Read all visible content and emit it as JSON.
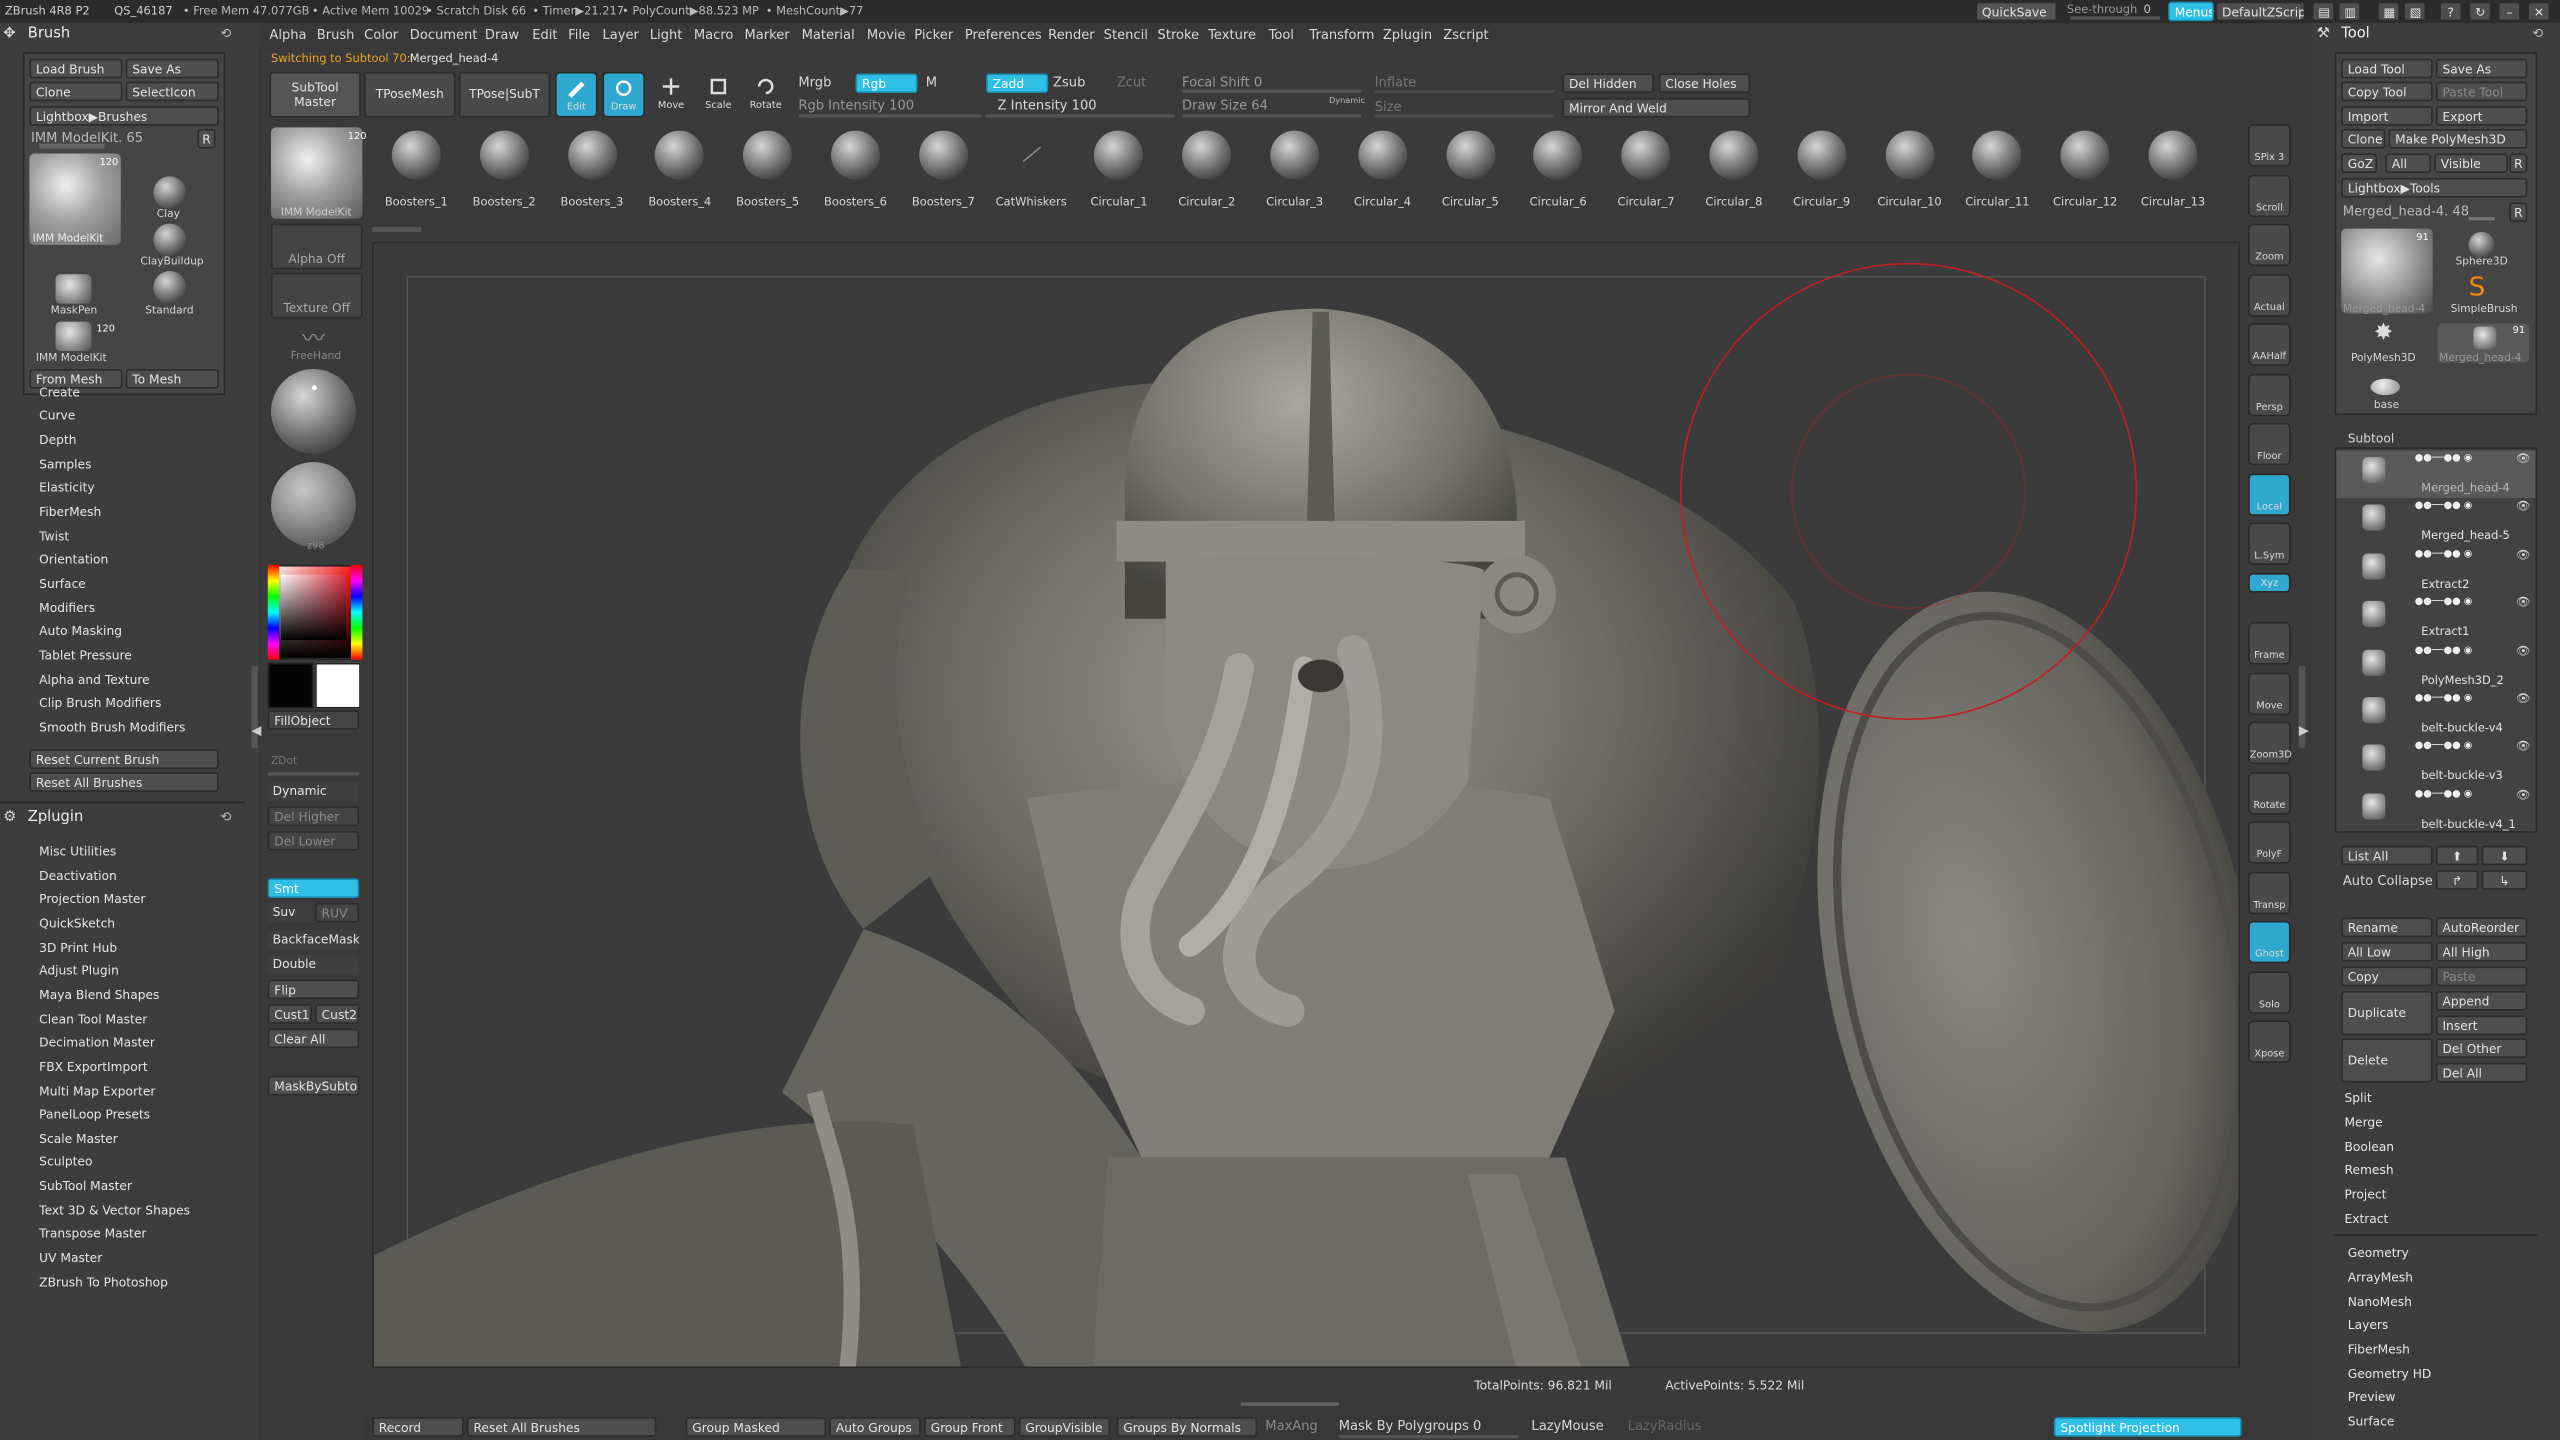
{
  "titlebar": {
    "app": "ZBrush 4R8 P2",
    "qs": "QS_46187",
    "free_mem": "• Free Mem 47.077GB",
    "active_mem": "• Active Mem 10029",
    "scratch": "• Scratch Disk 66",
    "timer": "• Timer▶21.217",
    "polycount": "• PolyCount▶88.523 MP",
    "meshcount": "• MeshCount▶77",
    "quicksave": "QuickSave",
    "seethrough": "See-through",
    "seethrough_value": "0",
    "menus": "Menus",
    "default_zscript": "DefaultZScript"
  },
  "menubar": [
    "Alpha",
    "Brush",
    "Color",
    "Document",
    "Draw",
    "Edit",
    "File",
    "Layer",
    "Light",
    "Macro",
    "Marker",
    "Material",
    "Movie",
    "Picker",
    "Preferences",
    "Render",
    "Stencil",
    "Stroke",
    "Texture",
    "Tool",
    "Transform",
    "Zplugin",
    "Zscript"
  ],
  "status_msg": "Switching to Subtool 70:",
  "status_value": "Merged_head-4",
  "top_toolbar": {
    "subtool_master": "SubTool Master",
    "tposemesh": "TPoseMesh",
    "tpose_subt": "TPose|SubT",
    "edit": "Edit",
    "draw": "Draw",
    "move": "Move",
    "scale": "Scale",
    "rotate": "Rotate",
    "mrgb": "Mrgb",
    "rgb": "Rgb",
    "m": "M",
    "rgb_intensity": "Rgb Intensity 100",
    "zadd": "Zadd",
    "zsub": "Zsub",
    "zcut": "Zcut",
    "z_intensity": "Z Intensity 100",
    "focal_shift": "Focal Shift 0",
    "draw_size": "Draw Size 64",
    "dynamic": "Dynamic",
    "inflate": "Inflate",
    "size": "Size",
    "del_hidden": "Del Hidden",
    "close_holes": "Close Holes",
    "mirror_weld": "Mirror And Weld"
  },
  "brush_shelf": [
    "Boosters_1",
    "Boosters_2",
    "Boosters_3",
    "Boosters_4",
    "Boosters_5",
    "Boosters_6",
    "Boosters_7",
    "CatWhiskers",
    "Circular_1",
    "Circular_2",
    "Circular_3",
    "Circular_4",
    "Circular_5",
    "Circular_6",
    "Circular_7",
    "Circular_8",
    "Circular_9",
    "Circular_10",
    "Circular_11",
    "Circular_12",
    "Circular_13"
  ],
  "left_panel": {
    "title": "Brush",
    "load_brush": "Load Brush",
    "save_as": "Save As",
    "clone": "Clone",
    "select_icon": "SelectIcon",
    "lightbox": "Lightbox▶Brushes",
    "imm_label": "IMM ModelKit. 65",
    "r": "R",
    "imm_thumb": "IMM ModelKit",
    "imm_count": "120",
    "clay": "Clay",
    "claybuildup": "ClayBuildup",
    "maskpen": "MaskPen",
    "standard": "Standard",
    "imm_thumb2": "IMM ModelKit",
    "imm_count2": "120",
    "from_mesh": "From Mesh",
    "to_mesh": "To Mesh",
    "sections": [
      "Create",
      "Curve",
      "Depth",
      "Samples",
      "Elasticity",
      "FiberMesh",
      "Twist",
      "Orientation",
      "Surface",
      "Modifiers",
      "Auto Masking",
      "Tablet Pressure",
      "Alpha and Texture",
      "Clip Brush Modifiers",
      "Smooth Brush Modifiers"
    ],
    "reset_current": "Reset Current Brush",
    "reset_all": "Reset All Brushes",
    "zplugin_title": "Zplugin",
    "plugins": [
      "Misc Utilities",
      "Deactivation",
      "Projection Master",
      "QuickSketch",
      "3D Print Hub",
      "Adjust Plugin",
      "Maya Blend Shapes",
      "Clean Tool Master",
      "Decimation Master",
      "FBX ExportImport",
      "Multi Map Exporter",
      "PanelLoop Presets",
      "Scale Master",
      "Sculpteo",
      "SubTool Master",
      "Text 3D & Vector Shapes",
      "Transpose Master",
      "UV Master",
      "ZBrush To Photoshop"
    ]
  },
  "vbar": {
    "imm_thumb": "IMM ModelKit",
    "imm_count": "120",
    "alpha_off": "Alpha Off",
    "texture_off": "Texture Off",
    "freehand": "FreeHand",
    "matcap": "z98",
    "fill_object": "FillObject",
    "zdot": "ZDot",
    "dynamic": "Dynamic",
    "del_higher": "Del Higher",
    "del_lower": "Del Lower",
    "smt": "Smt",
    "suv": "Suv",
    "ruv": "RUV",
    "backface": "BackfaceMask",
    "double": "Double",
    "flip": "Flip",
    "cust1": "Cust1",
    "cust2": "Cust2",
    "clear_all": "Clear All",
    "mask_by_subtool": "MaskBySubtool"
  },
  "right_shelf": [
    "SPix 3",
    "Scroll",
    "Zoom",
    "Actual",
    "AAHalf",
    "Persp",
    "Floor",
    "Local",
    "L.Sym",
    "Xyz",
    "Frame",
    "Move",
    "Zoom3D",
    "Rotate",
    "PolyF",
    "Transp",
    "Ghost",
    "Solo",
    "Xpose"
  ],
  "tool_panel": {
    "title": "Tool",
    "load_tool": "Load Tool",
    "save_as": "Save As",
    "copy_tool": "Copy Tool",
    "paste_tool": "Paste Tool",
    "import": "Import",
    "export": "Export",
    "clone": "Clone",
    "make_polymesh": "Make PolyMesh3D",
    "goz": "GoZ",
    "all": "All",
    "visible": "Visible",
    "r": "R",
    "lightbox": "Lightbox▶Tools",
    "merged_label": "Merged_head-4. 48",
    "r2": "R",
    "thumb_merged": "Merged_head-4",
    "thumb_count": "91",
    "sphere3d": "Sphere3D",
    "simplebrush": "SimpleBrush",
    "polymesh3d": "PolyMesh3D",
    "merged_small": "Merged_head-4",
    "merged_small_count": "91",
    "base": "base",
    "subtool_title": "Subtool",
    "subtools": [
      "Merged_head-4",
      "Merged_head-5",
      "Extract2",
      "Extract1",
      "PolyMesh3D_2",
      "belt-buckle-v4",
      "belt-buckle-v3",
      "belt-buckle-v4_1"
    ],
    "list_all": "List All",
    "auto_collapse": "Auto Collapse",
    "rename": "Rename",
    "autoreorder": "AutoReorder",
    "all_low": "All Low",
    "all_high": "All High",
    "copy": "Copy",
    "paste": "Paste",
    "append": "Append",
    "duplicate": "Duplicate",
    "insert": "Insert",
    "delete": "Delete",
    "del_other": "Del Other",
    "del_all": "Del All",
    "split": "Split",
    "merge": "Merge",
    "boolean": "Boolean",
    "remesh": "Remesh",
    "project": "Project",
    "extract": "Extract",
    "sections": [
      "Geometry",
      "ArrayMesh",
      "NanoMesh",
      "Layers",
      "FiberMesh",
      "Geometry HD",
      "Preview",
      "Surface"
    ]
  },
  "canvas_status": {
    "total_points": "TotalPoints: 96.821 Mil",
    "active_points": "ActivePoints: 5.522 Mil"
  },
  "bottombar": {
    "record": "Record",
    "reset_all": "Reset All Brushes",
    "group_masked": "Group Masked",
    "auto_groups": "Auto Groups",
    "group_front": "Group Front",
    "group_visible": "GroupVisible",
    "groups_by_normals": "Groups By Normals",
    "maxang": "MaxAng",
    "mask_by_polygroups": "Mask By Polygroups 0",
    "lazymouse": "LazyMouse",
    "lazyradius": "LazyRadius",
    "spotlight": "Spotlight Projection"
  },
  "colors": {
    "accent": "#2fc0e8",
    "panel": "#3d3d3d",
    "status_orange": "#f0a020",
    "brush_circle": "#c02020"
  }
}
